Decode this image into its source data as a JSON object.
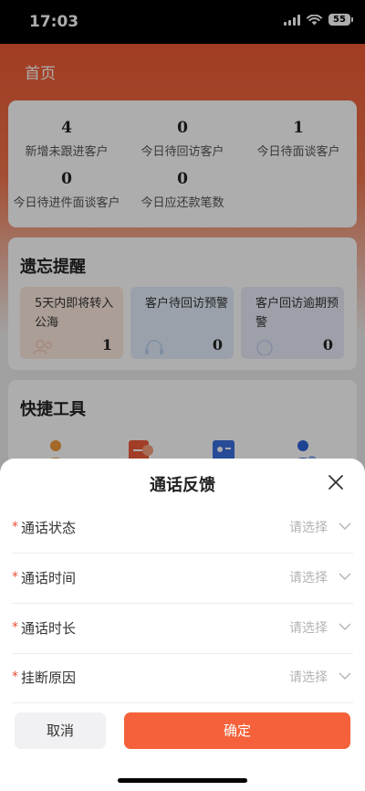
{
  "status_bar": {
    "time": "17:03",
    "battery": "55"
  },
  "page": {
    "title": "首页"
  },
  "stats": [
    {
      "value": "4",
      "label": "新增未跟进客户"
    },
    {
      "value": "0",
      "label": "今日待回访客户"
    },
    {
      "value": "1",
      "label": "今日待面谈客户"
    },
    {
      "value": "0",
      "label": "今日待进件面谈客户"
    },
    {
      "value": "0",
      "label": "今日应还款笔数"
    }
  ],
  "forget": {
    "title": "遗忘提醒",
    "items": [
      {
        "text": "5天内即将转入公海",
        "value": "1"
      },
      {
        "text": "客户待回访预警",
        "value": "0"
      },
      {
        "text": "客户回访逾期预警",
        "value": "0"
      }
    ]
  },
  "tools": {
    "title": "快捷工具"
  },
  "sheet": {
    "title": "通话反馈",
    "required_mark": "*",
    "fields": [
      {
        "label": "通话状态",
        "placeholder": "请选择"
      },
      {
        "label": "通话时间",
        "placeholder": "请选择"
      },
      {
        "label": "通话时长",
        "placeholder": "请选择"
      },
      {
        "label": "挂断原因",
        "placeholder": "请选择"
      }
    ],
    "cancel_label": "取消",
    "confirm_label": "确定"
  },
  "colors": {
    "accent": "#f4613a",
    "required": "#e8503a"
  },
  "icons": [
    "signal-icon",
    "wifi-icon",
    "battery-icon",
    "close-icon",
    "chevron-down-icon"
  ]
}
